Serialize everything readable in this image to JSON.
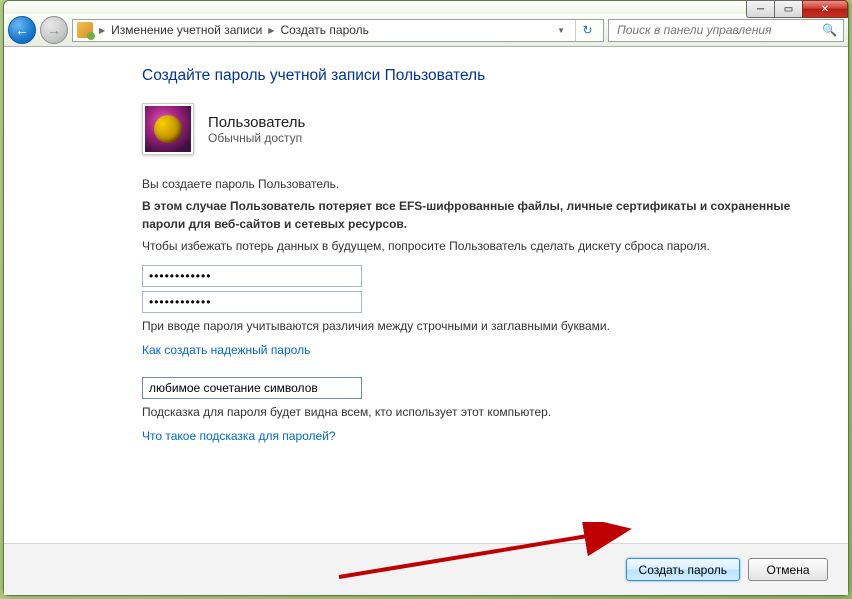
{
  "titlebar": {
    "minimize": "─",
    "maximize": "▭",
    "close": "✕"
  },
  "toolbar": {
    "back_glyph": "←",
    "fwd_glyph": "→",
    "crumb1": "Изменение учетной записи",
    "crumb2": "Создать пароль",
    "refresh_glyph": "↻",
    "search_placeholder": "Поиск в панели управления",
    "search_icon": "🔍"
  },
  "page": {
    "heading": "Создайте пароль учетной записи Пользователь",
    "user_name": "Пользователь",
    "user_type": "Обычный доступ",
    "line1": "Вы создаете пароль Пользователь.",
    "line2": "В этом случае Пользователь потеряет все EFS-шифрованные файлы, личные сертификаты и сохраненные пароли для веб-сайтов и сетевых ресурсов.",
    "line3": "Чтобы избежать потерь данных в будущем, попросите Пользователь сделать дискету сброса пароля.",
    "pw1_value": "●●●●●●●●●●●●",
    "pw2_value": "●●●●●●●●●●●●",
    "case_note": "При вводе пароля учитываются различия между строчными и заглавными буквами.",
    "link_strong": "Как создать надежный пароль",
    "hint_value": "любимое сочетание символов",
    "hint_note": "Подсказка для пароля будет видна всем, кто использует этот компьютер.",
    "link_hint": "Что такое подсказка для паролей?"
  },
  "footer": {
    "create": "Создать пароль",
    "cancel": "Отмена"
  }
}
